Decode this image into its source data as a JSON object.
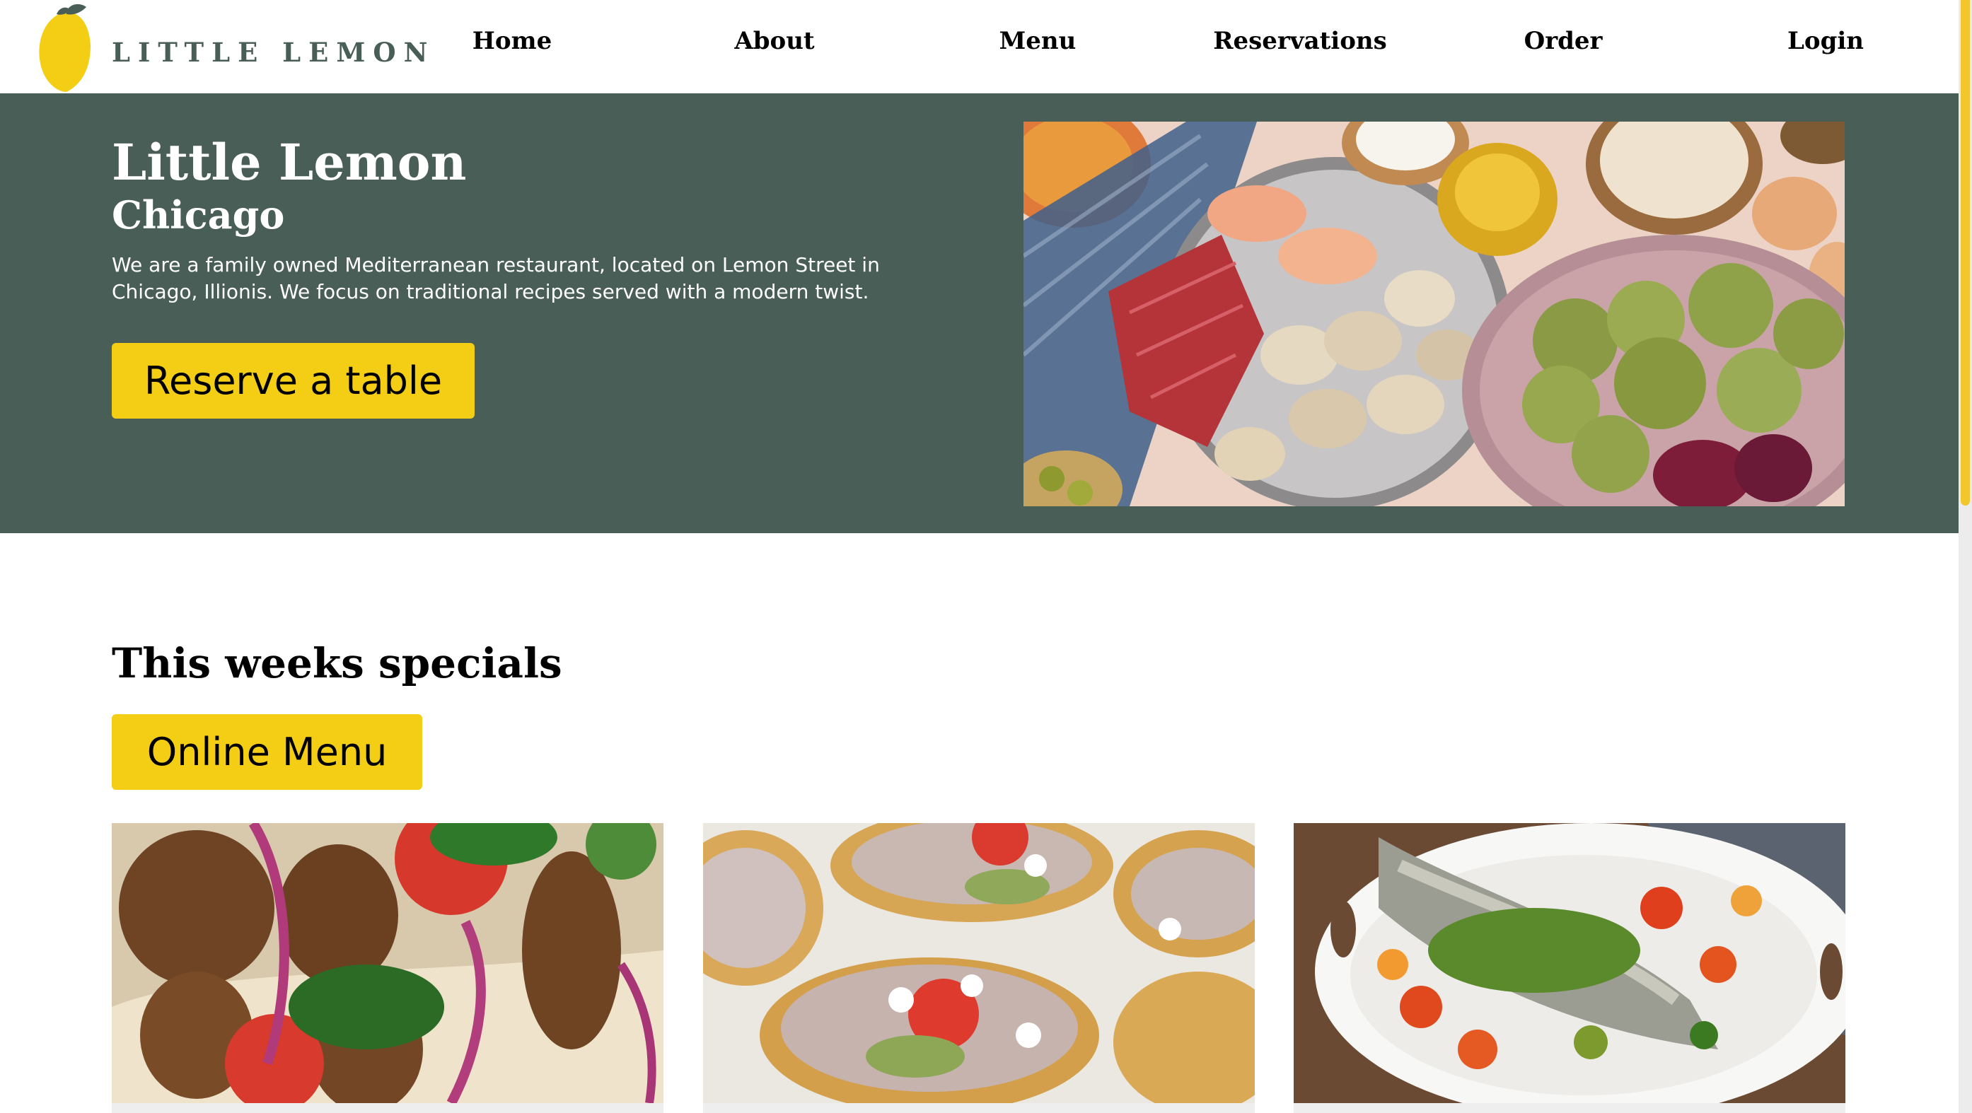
{
  "brand": {
    "logo_text": "LITTLE LEMON",
    "colors": {
      "primary_green": "#495e57",
      "primary_yellow": "#f4ce14"
    }
  },
  "nav": {
    "items": [
      {
        "label": "Home"
      },
      {
        "label": "About"
      },
      {
        "label": "Menu"
      },
      {
        "label": "Reservations"
      },
      {
        "label": "Order"
      },
      {
        "label": "Login"
      }
    ]
  },
  "hero": {
    "title": "Little Lemon",
    "subtitle": "Chicago",
    "description": "We are a family owned Mediterranean restaurant, located on Lemon Street in Chicago, Illionis. We focus on traditional recipes served with a modern twist.",
    "reserve_button": "Reserve a table",
    "image": "mediterranean-ingredients-photo"
  },
  "specials": {
    "title": "This weeks specials",
    "menu_button": "Online Menu",
    "cards": [
      {
        "image": "falafel-pita-photo"
      },
      {
        "image": "bruschetta-photo"
      },
      {
        "image": "baked-fish-platter-photo"
      }
    ]
  }
}
